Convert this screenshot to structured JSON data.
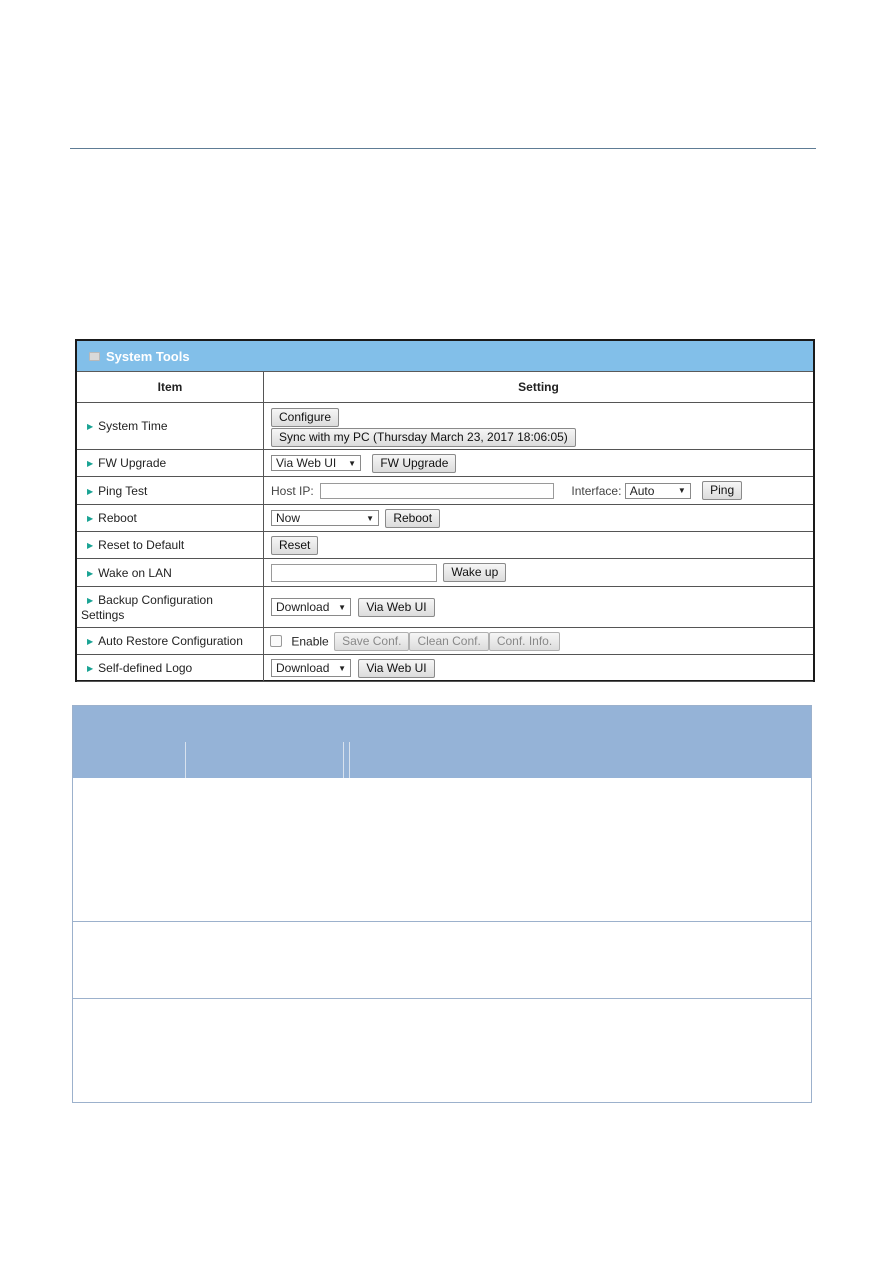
{
  "panel": {
    "title": "System Tools",
    "columns": [
      "Item",
      "Setting"
    ],
    "rows": {
      "system_time": {
        "label": "System Time",
        "configure": "Configure",
        "sync": "Sync with my PC (Thursday March 23, 2017 18:06:05)"
      },
      "fw_upgrade": {
        "label": "FW Upgrade",
        "method": "Via Web UI",
        "button": "FW Upgrade"
      },
      "ping_test": {
        "label": "Ping Test",
        "host_label": "Host IP:",
        "host_value": "",
        "interface_label": "Interface:",
        "interface_value": "Auto",
        "button": "Ping"
      },
      "reboot": {
        "label": "Reboot",
        "when": "Now",
        "button": "Reboot"
      },
      "reset": {
        "label": "Reset to Default",
        "button": "Reset"
      },
      "wol": {
        "label": "Wake on LAN",
        "value": "",
        "button": "Wake up"
      },
      "backup": {
        "label_1": "Backup Configuration",
        "label_2": "Settings",
        "action": "Download",
        "button": "Via Web UI"
      },
      "auto_restore": {
        "label": "Auto Restore Configuration",
        "enable_label": "Enable",
        "enabled": false,
        "save": "Save Conf.",
        "clean": "Clean Conf.",
        "info": "Conf. Info."
      },
      "logo": {
        "label": "Self-defined Logo",
        "action": "Download",
        "button": "Via Web UI"
      }
    }
  },
  "icons": {
    "arrow": "▶",
    "caret": "▼"
  }
}
